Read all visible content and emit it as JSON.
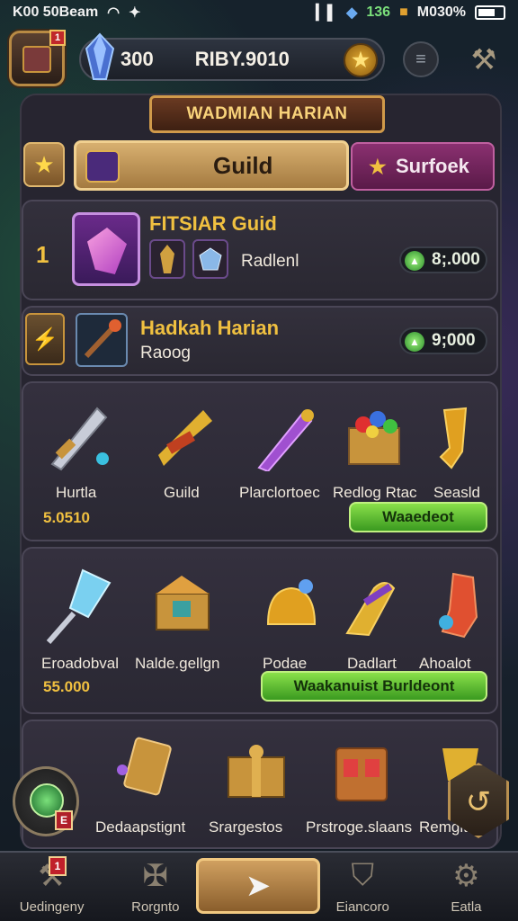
{
  "status_bar": {
    "left_text": "K00 50Beam",
    "center_number": "136",
    "right_text": "M030%"
  },
  "top_bar": {
    "avatar_badge": "1",
    "resource_amount": "300",
    "resource_label": "RIBY.9010"
  },
  "banner": {
    "title": "WADMIAN HARIAN"
  },
  "tabs": {
    "guild_label": "Guild",
    "other_label": "Surfoek"
  },
  "row_featured": {
    "rank": "1",
    "title": "FITSIAR Guid",
    "subtitle": "Radlenl",
    "price": "8;.000"
  },
  "row_second": {
    "title": "Hadkah Harian",
    "subtitle": "Raoog",
    "price": "9;000"
  },
  "panel_1": {
    "items": [
      {
        "label": "Hurtla",
        "icon": "sword-icon"
      },
      {
        "label": "Guild",
        "icon": "crossbow-icon"
      },
      {
        "label": "Plarclortoec",
        "icon": "dagger-icon"
      },
      {
        "label": "Redlog Rtac",
        "icon": "gem-chest-icon"
      },
      {
        "label": "Seasld",
        "icon": "horn-icon"
      }
    ],
    "price": "5.0510",
    "button_label": "Waaedeot"
  },
  "panel_2": {
    "items": [
      {
        "label": "Eroadobval",
        "icon": "crystal-staff-icon"
      },
      {
        "label": "Nalde.gellgn",
        "icon": "treasure-chest-icon"
      },
      {
        "label": "Podae",
        "icon": "bell-icon"
      },
      {
        "label": "Dadlart",
        "icon": "magnet-icon"
      },
      {
        "label": "Ahoalot",
        "icon": "boot-icon"
      }
    ],
    "price": "55.000",
    "button_label": "Waakanuist Burldeont"
  },
  "panel_3": {
    "items": [
      {
        "label": "Dedaapstignt",
        "icon": "card-icon"
      },
      {
        "label": "Srargestos",
        "icon": "gift-box-icon"
      },
      {
        "label": "Prstroge.slaans",
        "icon": "scroll-chest-icon"
      },
      {
        "label": "Remgit",
        "icon": "trophy-icon"
      }
    ]
  },
  "side_badge": "E",
  "bottom_nav": {
    "items": [
      {
        "label": "Uedingeny",
        "icon": "axe-icon"
      },
      {
        "label": "Rorgnto",
        "icon": "hammer-icon"
      },
      {
        "label": "",
        "icon": "arrow-icon"
      },
      {
        "label": "Eiancoro",
        "icon": "shield-icon"
      },
      {
        "label": "Eatla",
        "icon": "gear-icon"
      }
    ],
    "badge": "1"
  },
  "colors": {
    "gold": "#f0c040",
    "green": "#6ac83a",
    "purple": "#8a3070",
    "panel": "#272530"
  }
}
